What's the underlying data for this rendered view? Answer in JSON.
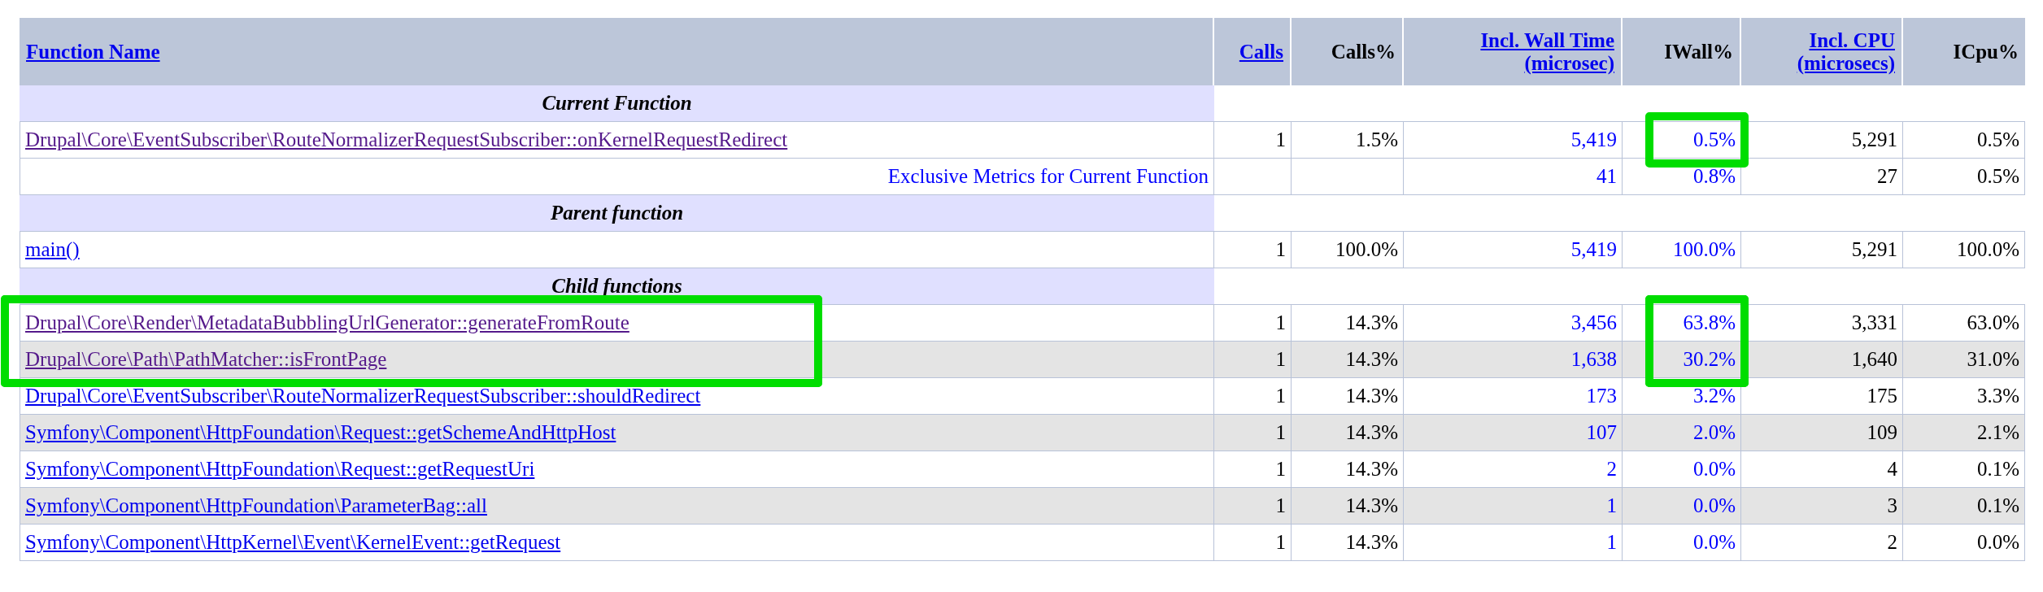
{
  "columns": [
    {
      "label": "Function Name",
      "link": true
    },
    {
      "label": "Calls",
      "link": true
    },
    {
      "label": "Calls%",
      "link": false
    },
    {
      "label": "Incl. Wall Time (microsec)",
      "link": true
    },
    {
      "label": "IWall%",
      "link": false
    },
    {
      "label": "Incl. CPU (microsecs)",
      "link": true
    },
    {
      "label": "ICpu%",
      "link": false
    }
  ],
  "sections": [
    {
      "title": "Current Function",
      "rows": [
        {
          "kind": "function",
          "name": "Drupal\\Core\\EventSubscriber\\RouteNormalizerRequestSubscriber::onKernelRequestRedirect",
          "visited": true,
          "shaded": false,
          "name_highlighted": false,
          "iwall_highlighted": true,
          "calls": "1",
          "calls_pct": "1.5%",
          "wall": "5,419",
          "iwall": "0.5%",
          "cpu": "5,291",
          "icpu": "0.5%"
        },
        {
          "kind": "exclusive",
          "name": "Exclusive Metrics for Current Function",
          "shaded": false,
          "name_highlighted": false,
          "iwall_highlighted": false,
          "wall": "41",
          "iwall": "0.8%",
          "cpu": "27",
          "icpu": "0.5%"
        }
      ]
    },
    {
      "title": "Parent function",
      "rows": [
        {
          "kind": "function",
          "name": "main()",
          "visited": false,
          "shaded": false,
          "name_highlighted": false,
          "iwall_highlighted": false,
          "calls": "1",
          "calls_pct": "100.0%",
          "wall": "5,419",
          "iwall": "100.0%",
          "cpu": "5,291",
          "icpu": "100.0%"
        }
      ]
    },
    {
      "title": "Child functions",
      "rows": [
        {
          "kind": "function",
          "name": "Drupal\\Core\\Render\\MetadataBubblingUrlGenerator::generateFromRoute",
          "visited": true,
          "shaded": false,
          "name_highlighted": true,
          "iwall_highlighted": true,
          "calls": "1",
          "calls_pct": "14.3%",
          "wall": "3,456",
          "iwall": "63.8%",
          "cpu": "3,331",
          "icpu": "63.0%"
        },
        {
          "kind": "function",
          "name": "Drupal\\Core\\Path\\PathMatcher::isFrontPage",
          "visited": true,
          "shaded": true,
          "name_highlighted": true,
          "iwall_highlighted": true,
          "calls": "1",
          "calls_pct": "14.3%",
          "wall": "1,638",
          "iwall": "30.2%",
          "cpu": "1,640",
          "icpu": "31.0%"
        },
        {
          "kind": "function",
          "name": "Drupal\\Core\\EventSubscriber\\RouteNormalizerRequestSubscriber::shouldRedirect",
          "visited": false,
          "shaded": false,
          "name_highlighted": false,
          "iwall_highlighted": false,
          "calls": "1",
          "calls_pct": "14.3%",
          "wall": "173",
          "iwall": "3.2%",
          "cpu": "175",
          "icpu": "3.3%"
        },
        {
          "kind": "function",
          "name": "Symfony\\Component\\HttpFoundation\\Request::getSchemeAndHttpHost",
          "visited": false,
          "shaded": true,
          "name_highlighted": false,
          "iwall_highlighted": false,
          "calls": "1",
          "calls_pct": "14.3%",
          "wall": "107",
          "iwall": "2.0%",
          "cpu": "109",
          "icpu": "2.1%"
        },
        {
          "kind": "function",
          "name": "Symfony\\Component\\HttpFoundation\\Request::getRequestUri",
          "visited": false,
          "shaded": false,
          "name_highlighted": false,
          "iwall_highlighted": false,
          "calls": "1",
          "calls_pct": "14.3%",
          "wall": "2",
          "iwall": "0.0%",
          "cpu": "4",
          "icpu": "0.1%"
        },
        {
          "kind": "function",
          "name": "Symfony\\Component\\HttpFoundation\\ParameterBag::all",
          "visited": false,
          "shaded": true,
          "name_highlighted": false,
          "iwall_highlighted": false,
          "calls": "1",
          "calls_pct": "14.3%",
          "wall": "1",
          "iwall": "0.0%",
          "cpu": "3",
          "icpu": "0.1%"
        },
        {
          "kind": "function",
          "name": "Symfony\\Component\\HttpKernel\\Event\\KernelEvent::getRequest",
          "visited": false,
          "shaded": false,
          "name_highlighted": false,
          "iwall_highlighted": false,
          "calls": "1",
          "calls_pct": "14.3%",
          "wall": "1",
          "iwall": "0.0%",
          "cpu": "2",
          "icpu": "0.0%"
        }
      ]
    }
  ]
}
